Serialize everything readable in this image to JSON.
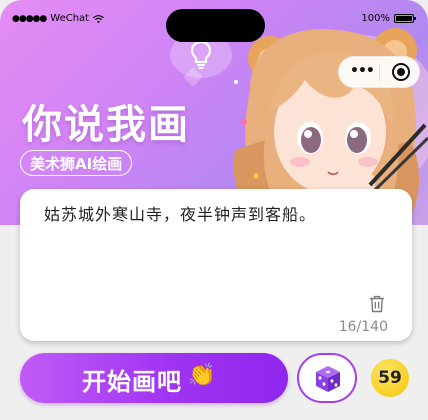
{
  "status_bar": {
    "carrier": "WeChat",
    "battery": "100%"
  },
  "banner": {
    "title": "你说我画",
    "subtitle": "美术狮AI绘画"
  },
  "capsule": {
    "more_label": "•••"
  },
  "prompt": {
    "text": "姑苏城外寒山寺，夜半钟声到客船。",
    "counter": "16/140"
  },
  "actions": {
    "start_label": "开始画吧",
    "clap_glyph": "👏",
    "coins": "59"
  },
  "icons": {
    "lightbulb": "lightbulb-icon",
    "trash": "trash-icon",
    "dice": "dice-icon",
    "more": "more-dots-icon",
    "close": "target-close-icon",
    "wifi": "wifi-icon",
    "battery": "battery-icon"
  },
  "colors": {
    "accent": "#a134f2",
    "banner_start": "#e58cf5",
    "coin": "#f8cf22"
  }
}
